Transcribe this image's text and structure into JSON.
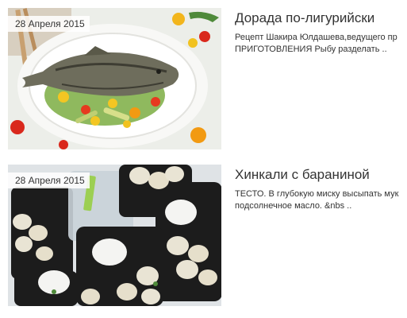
{
  "articles": [
    {
      "date": "28 Апреля 2015",
      "title": "Дорада по-лигурийски",
      "excerpt_line1": "Рецепт Шакира Юлдашева,ведущего пр",
      "excerpt_line2": "ПРИГОТОВЛЕНИЯ Рыбу разделать ..",
      "image_subject": "grilled-dorado-fish-plate"
    },
    {
      "date": "28 Апреля 2015",
      "title": "Хинкали с бараниной",
      "excerpt_line1": "ТЕСТО. В глубокую миску высыпать мук",
      "excerpt_line2": "подсолнечное масло. &nbs ..",
      "image_subject": "khinkali-containers"
    }
  ],
  "colors": {
    "text": "#333333",
    "badge_bg": "#ffffff"
  }
}
